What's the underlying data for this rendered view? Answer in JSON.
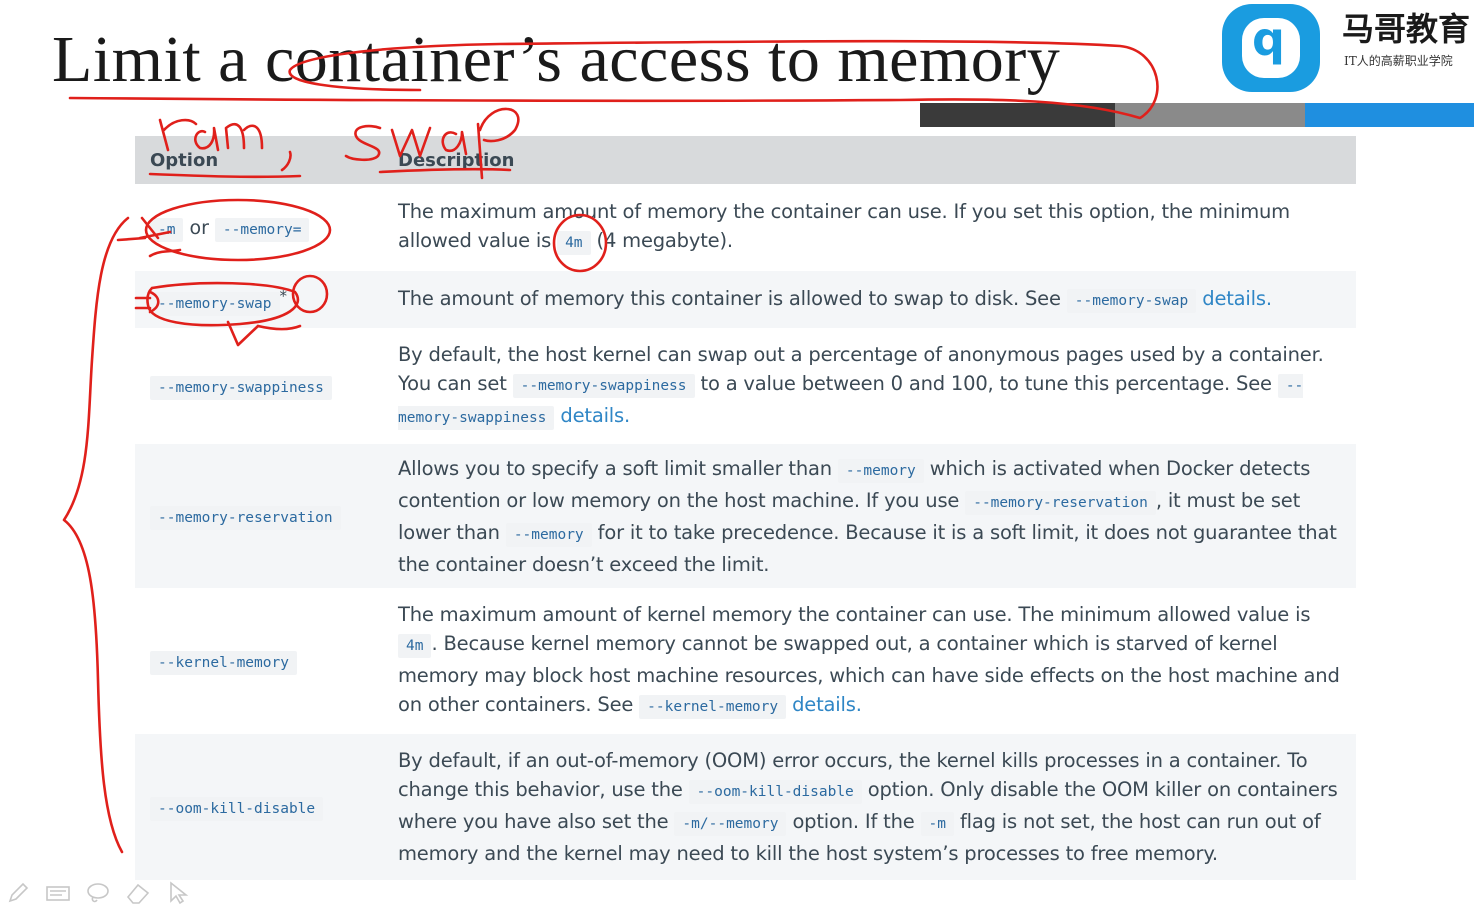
{
  "slide": {
    "title": "Limit a container’s access to memory"
  },
  "logo": {
    "name": "马哥教育",
    "slogan": "IT人的高薪职业学院"
  },
  "table": {
    "headers": {
      "option": "Option",
      "description": "Description"
    },
    "rows": [
      {
        "option_a": "-m",
        "option_or": "or",
        "option_b": "--memory=",
        "desc": [
          "The maximum amount of memory the container can use. If you set this option, the minimum allowed value is ",
          "4m",
          " (4 megabyte)."
        ]
      },
      {
        "option": "--memory-swap",
        "option_star": "*",
        "desc": [
          "The amount of memory this container is allowed to swap to disk. See ",
          "--memory-swap",
          " ",
          "details."
        ]
      },
      {
        "option": "--memory-swappiness",
        "desc": [
          "By default, the host kernel can swap out a percentage of anonymous pages used by a container. You can set ",
          "--memory-swappiness",
          " to a value between 0 and 100, to tune this percentage. See ",
          "--memory-swappiness",
          " ",
          "details."
        ]
      },
      {
        "option": "--memory-reservation",
        "desc": [
          "Allows you to specify a soft limit smaller than ",
          "--memory",
          " which is activated when Docker detects contention or low memory on the host machine. If you use ",
          "--memory-reservation",
          ", it must be set lower than ",
          "--memory",
          " for it to take precedence. Because it is a soft limit, it does not guarantee that the container doesn’t exceed the limit."
        ]
      },
      {
        "option": "--kernel-memory",
        "desc": [
          "The maximum amount of kernel memory the container can use. The minimum allowed value is ",
          "4m",
          ". Because kernel memory cannot be swapped out, a container which is starved of kernel memory may block host machine resources, which can have side effects on the host machine and on other containers. See ",
          "--kernel-memory",
          " ",
          "details."
        ]
      },
      {
        "option": "--oom-kill-disable",
        "desc": [
          "By default, if an out-of-memory (OOM) error occurs, the kernel kills processes in a container. To change this behavior, use the ",
          "--oom-kill-disable",
          " option. Only disable the OOM killer on containers where you have also set the ",
          "-m/--memory",
          " option. If the ",
          "-m",
          " flag is not set, the host can run out of memory and the kernel may need to kill the host system’s processes to free memory."
        ]
      }
    ]
  },
  "annotation": {
    "handwriting": "ram, swap"
  },
  "toolbar": {
    "tools": [
      "pen-icon",
      "highlighter-icon",
      "lasso-icon",
      "eraser-icon",
      "pointer-icon"
    ]
  },
  "colors": {
    "ink": "#e0201b",
    "code": "#2c6aa0",
    "link": "#2f86c6",
    "header_bg": "#d8dadc",
    "brand_blue": "#1a9ce0"
  }
}
